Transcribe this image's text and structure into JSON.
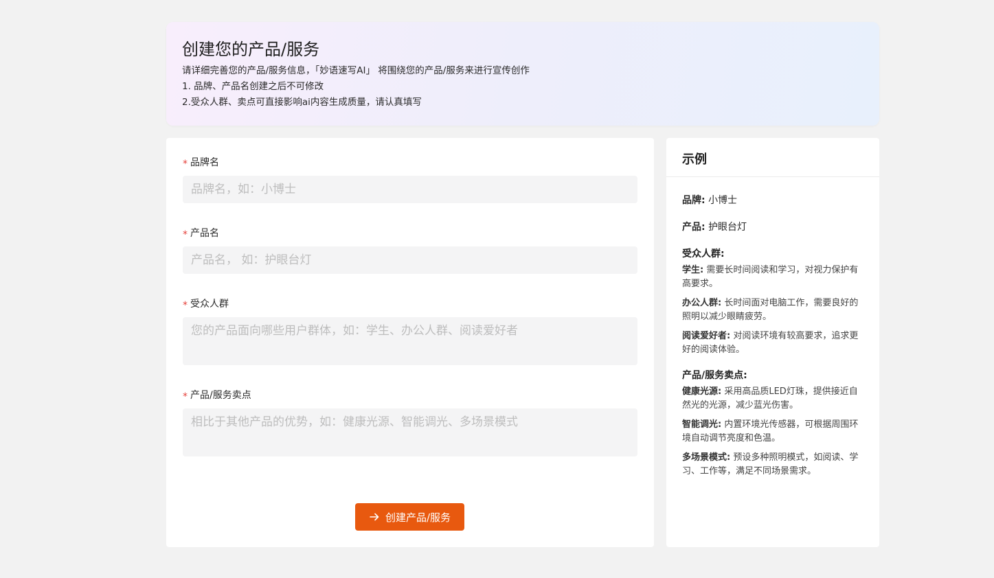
{
  "banner": {
    "title": "创建您的产品/服务",
    "desc": "请详细完善您的产品/服务信息，「妙语速写AI」 将围绕您的产品/服务来进行宣传创作",
    "note1": "1. 品牌、产品名创建之后不可修改",
    "note2": "2.受众人群、卖点可直接影响ai内容生成质量，请认真填写"
  },
  "form": {
    "required_mark": "*",
    "brand": {
      "label": "品牌名",
      "placeholder": "品牌名，如：小博士"
    },
    "product": {
      "label": "产品名",
      "placeholder": "产品名， 如：护眼台灯"
    },
    "audience": {
      "label": "受众人群",
      "placeholder": "您的产品面向哪些用户群体，如：学生、办公人群、阅读爱好者"
    },
    "selling_points": {
      "label": "产品/服务卖点",
      "placeholder": "相比于其他产品的优势，如：健康光源、智能调光、多场景模式"
    },
    "submit_label": "创建产品/服务",
    "submit_icon": "arrow-right-icon",
    "accent_color": "#e8590f"
  },
  "example": {
    "title": "示例",
    "brand_key": "品牌:",
    "brand_value": "小博士",
    "product_key": "产品:",
    "product_value": "护眼台灯",
    "audience_title": "受众人群:",
    "audience_items": [
      {
        "key": "学生:",
        "text": "需要长时间阅读和学习，对视力保护有高要求。"
      },
      {
        "key": "办公人群:",
        "text": "长时间面对电脑工作，需要良好的照明以减少眼睛疲劳。"
      },
      {
        "key": "阅读爱好者:",
        "text": "对阅读环境有较高要求，追求更好的阅读体验。"
      }
    ],
    "selling_title": "产品/服务卖点:",
    "selling_items": [
      {
        "key": "健康光源:",
        "text": "采用高品质LED灯珠，提供接近自然光的光源，减少蓝光伤害。"
      },
      {
        "key": "智能调光:",
        "text": "内置环境光传感器，可根据周围环境自动调节亮度和色温。"
      },
      {
        "key": "多场景模式:",
        "text": "预设多种照明模式，如阅读、学习、工作等，满足不同场景需求。"
      }
    ]
  }
}
